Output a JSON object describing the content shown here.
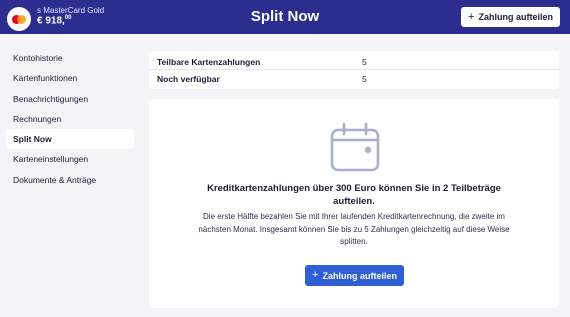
{
  "header": {
    "card_name": "s MasterCard Gold",
    "card_balance_main": "€ 918,",
    "card_balance_cents": "00",
    "title": "Split Now",
    "action_label": "Zahlung aufteilen",
    "action_icon": "plus-icon",
    "background_color": "#2b2e8f"
  },
  "sidebar": {
    "items": [
      {
        "label": "Kontohistorie",
        "active": false
      },
      {
        "label": "Kartenfunktionen",
        "active": false
      },
      {
        "label": "Benachrichtigungen",
        "active": false
      },
      {
        "label": "Rechnungen",
        "active": false
      },
      {
        "label": "Split Now",
        "active": true
      },
      {
        "label": "Karteneinstellungen",
        "active": false
      },
      {
        "label": "Dokumente & Anträge",
        "active": false
      }
    ]
  },
  "info": {
    "rows": [
      {
        "label": "Teilbare Kartenzahlungen",
        "value": "5"
      },
      {
        "label": "Noch verfügbar",
        "value": "5"
      }
    ]
  },
  "main": {
    "icon": "calendar-icon",
    "headline": "Kreditkartenzahlungen über 300 Euro können Sie in 2 Teilbeträge aufteilen.",
    "description": "Die erste Hälfte bezahlen Sie mit Ihrer laufenden Kreditkartenrechnung, die zweite im nächsten Monat. Insgesamt können Sie bis zu 5 Zahlungen gleichzeitig auf diese Weise splitten.",
    "button_label": "Zahlung aufteilen",
    "button_color": "#2f5fd7"
  }
}
